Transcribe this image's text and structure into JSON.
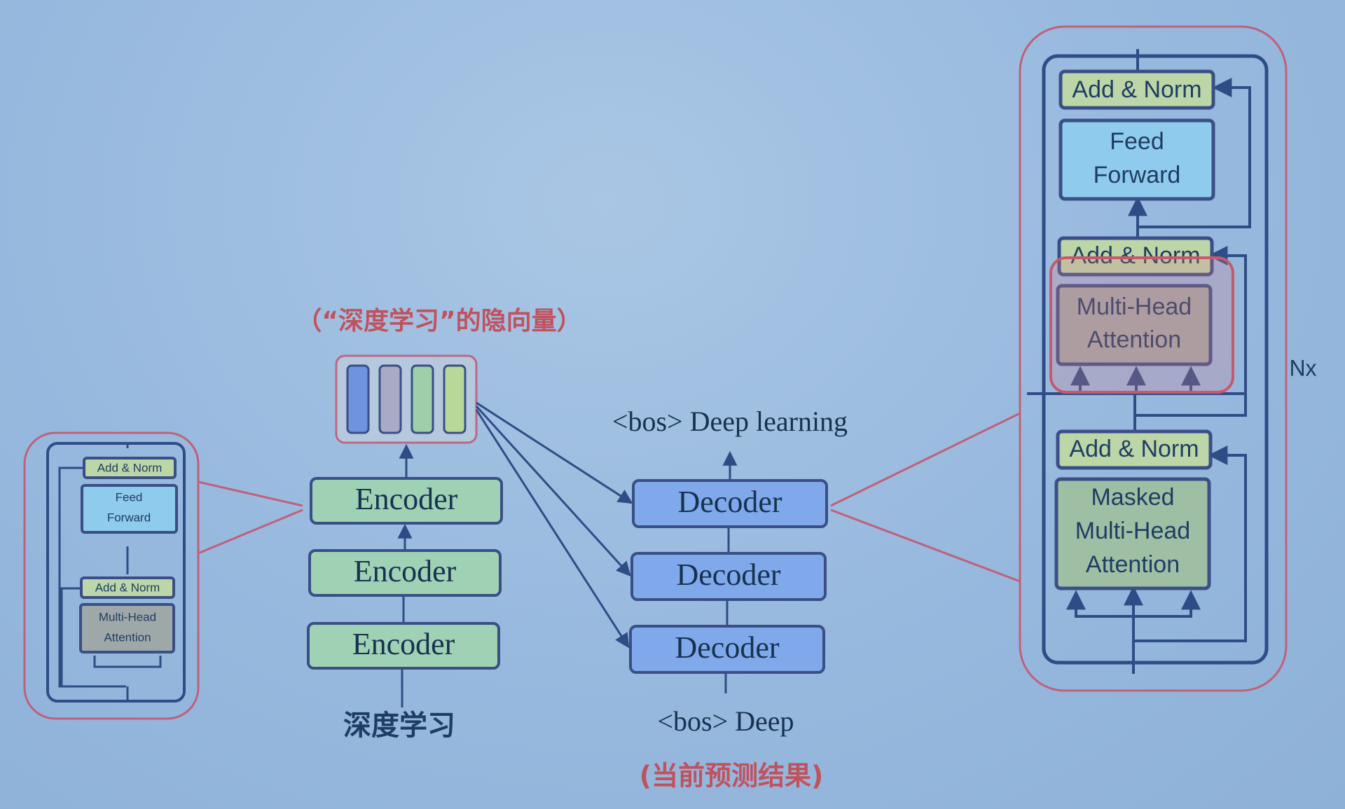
{
  "hidden_vector_caption": "（“深度学习”的隐向量）",
  "encoder_stack": {
    "labels": [
      "Encoder",
      "Encoder",
      "Encoder"
    ],
    "input": "深度学习"
  },
  "decoder_stack": {
    "labels": [
      "Decoder",
      "Decoder",
      "Decoder"
    ],
    "output": "<bos> Deep learning",
    "input": "<bos> Deep",
    "input_note": "(当前预测结果)"
  },
  "encoder_detail": {
    "add_norm_top": "Add & Norm",
    "feed_forward": [
      "Feed",
      "Forward"
    ],
    "add_norm_bottom": "Add & Norm",
    "attention": [
      "Multi-Head",
      "Attention"
    ]
  },
  "decoder_detail": {
    "add_norm_top": "Add & Norm",
    "feed_forward": [
      "Feed",
      "Forward"
    ],
    "add_norm_mid": "Add & Norm",
    "cross_attention": [
      "Multi-Head",
      "Attention"
    ],
    "add_norm_bottom": "Add & Norm",
    "masked_attention": [
      "Masked",
      "Multi-Head",
      "Attention"
    ],
    "repeat_label": "Nx"
  },
  "colors": {
    "encoder_fill": "#9fd1b4",
    "decoder_fill": "#7fa9ea",
    "add_norm_fill": "#bcd6a8",
    "feed_forward_fill": "#8fcbec",
    "attention_fill": "#9fa8a8",
    "masked_fill": "#9fbfa4",
    "outline": "#3a4f86",
    "highlight": "#c76a7a",
    "vector_colors": [
      "#6f93de",
      "#a9aac4",
      "#9fcfa8",
      "#b8d89a"
    ]
  }
}
